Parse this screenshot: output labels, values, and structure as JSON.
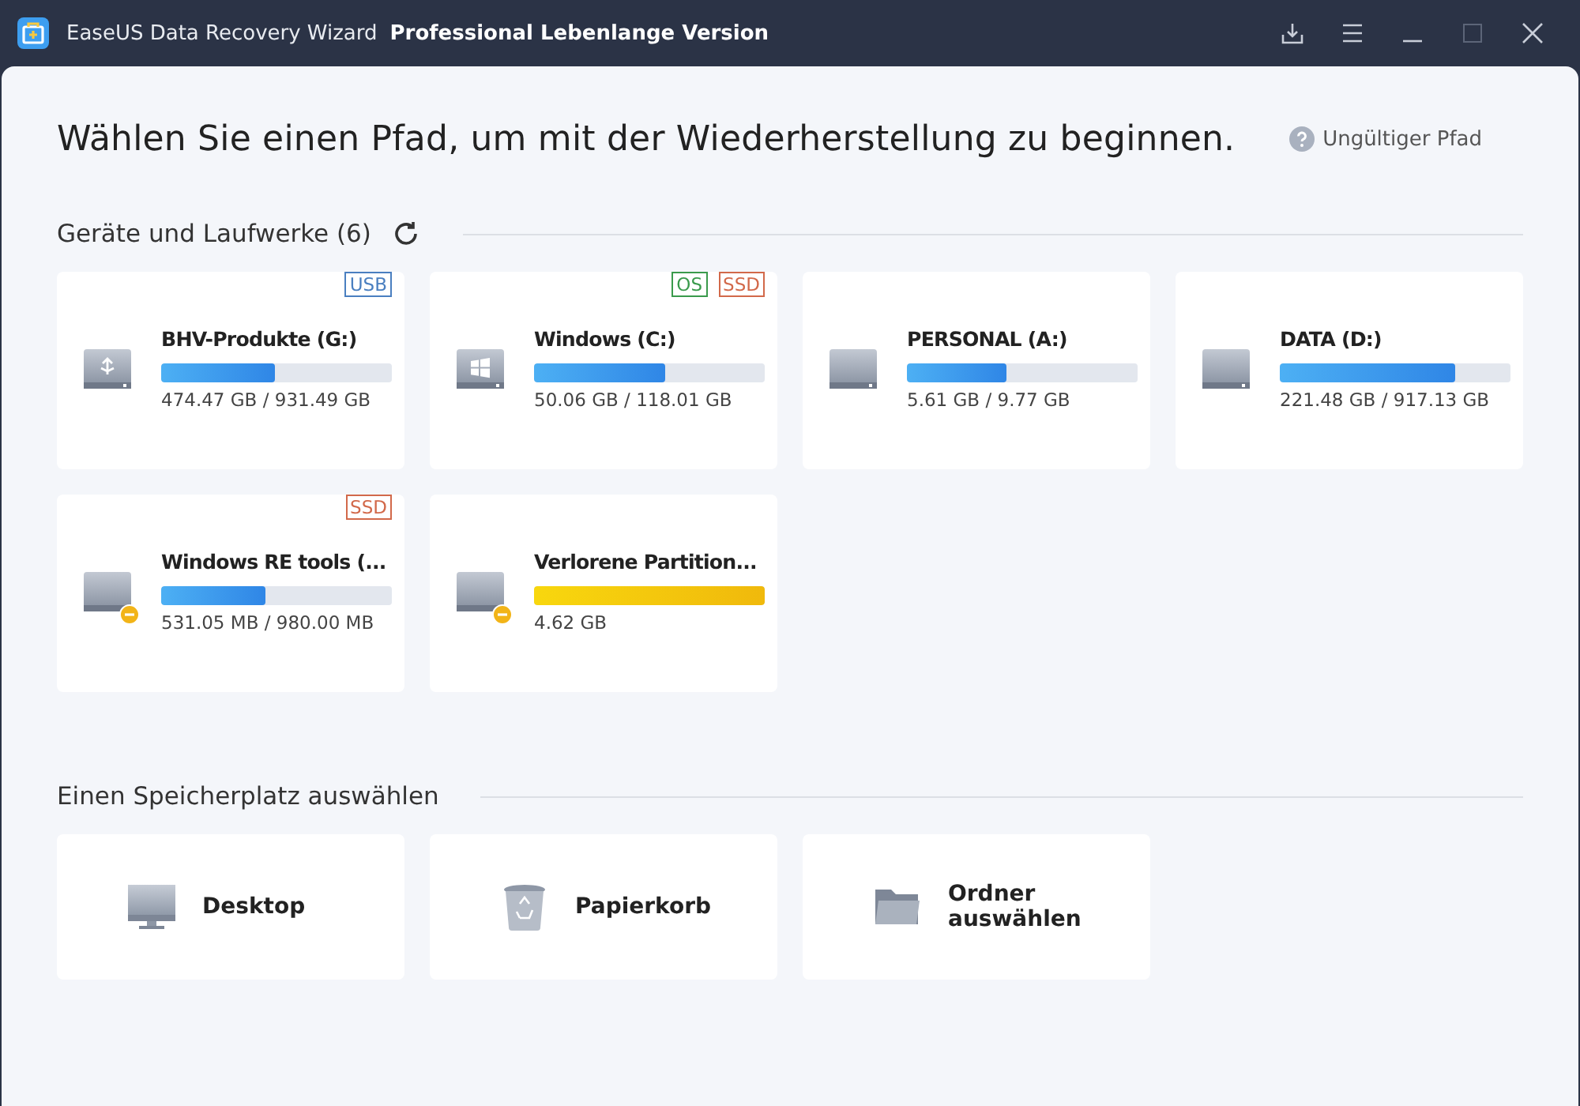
{
  "window": {
    "app_name": "EaseUS Data Recovery Wizard",
    "edition": "Professional Lebenlange Version"
  },
  "heading": "Wählen Sie einen Pfad, um mit der Wiederherstellung zu beginnen.",
  "help_link": "Ungültiger Pfad",
  "devices_section": {
    "title": "Geräte und Laufwerke (6)"
  },
  "drives": [
    {
      "name": "BHV-Produkte (G:)",
      "kind": "usb",
      "warning": false,
      "level": 0.49,
      "size": "474.47 GB / 931.49 GB",
      "tags": [
        {
          "label": "USB",
          "color": "#4a7fc0"
        }
      ]
    },
    {
      "name": "Windows (C:)",
      "kind": "windows",
      "warning": false,
      "level": 0.57,
      "size": "50.06 GB / 118.01 GB",
      "tags": [
        {
          "label": "OS",
          "color": "#3a9a4c"
        },
        {
          "label": "SSD",
          "color": "#d2694a"
        }
      ]
    },
    {
      "name": "PERSONAL (A:)",
      "kind": "disk",
      "warning": false,
      "level": 0.43,
      "size": "5.61 GB / 9.77 GB"
    },
    {
      "name": "DATA (D:)",
      "kind": "disk",
      "warning": false,
      "level": 0.76,
      "size": "221.48 GB / 917.13 GB"
    },
    {
      "name": "Windows RE tools (...",
      "kind": "disk",
      "warning": true,
      "level": 0.45,
      "size": "531.05 MB / 980.00 MB",
      "tags": [
        {
          "label": "SSD",
          "color": "#d2694a"
        }
      ]
    },
    {
      "name": "Verlorene Partition...",
      "kind": "disk",
      "warning": true,
      "level": 1,
      "size": "4.62 GB"
    }
  ],
  "locations_section": {
    "title": "Einen Speicherplatz auswählen"
  },
  "locations": [
    {
      "label": "Desktop",
      "kind": "desktop"
    },
    {
      "label": "Papierkorb",
      "kind": "trash"
    },
    {
      "label": "Ordner auswählen",
      "kind": "folder"
    }
  ]
}
